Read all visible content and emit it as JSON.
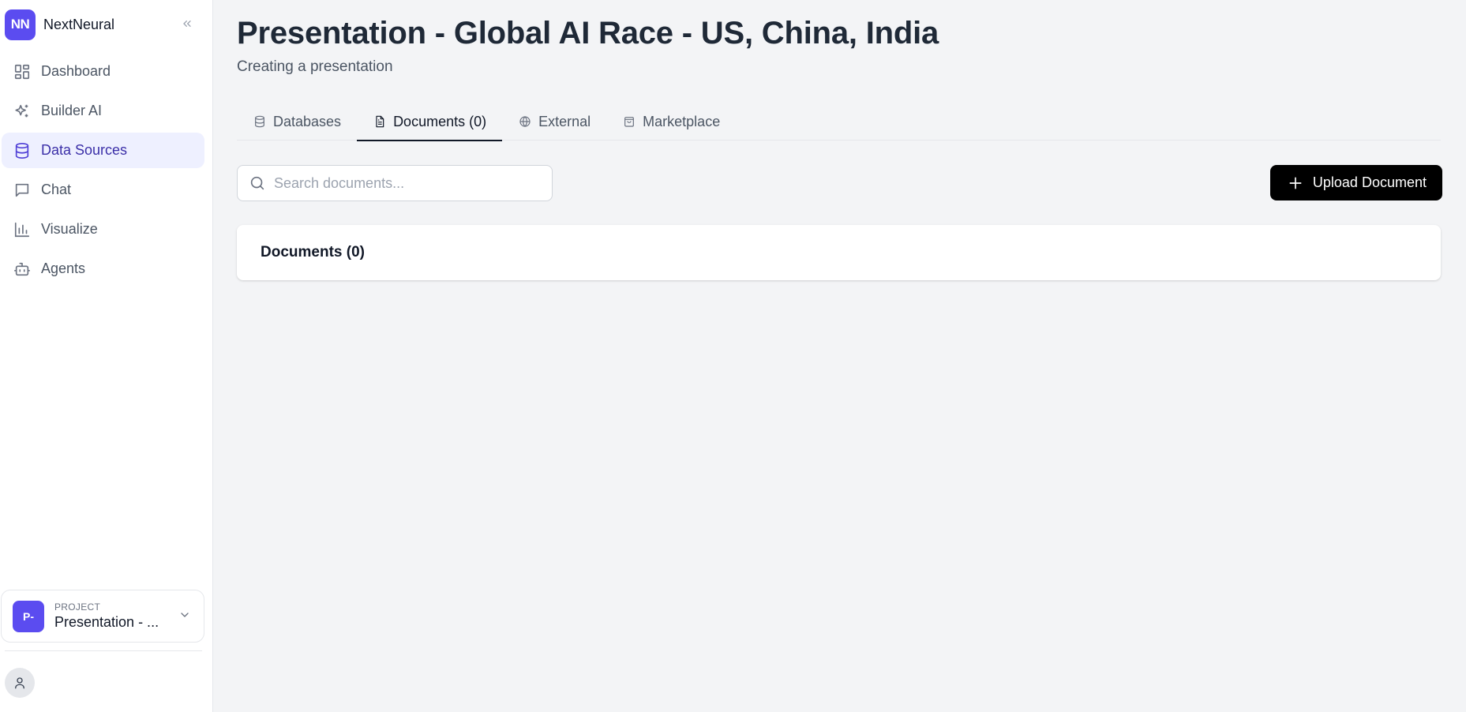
{
  "brand": {
    "logo_text": "NN",
    "name": "NextNeural"
  },
  "sidebar": {
    "items": [
      {
        "label": "Dashboard",
        "icon": "dashboard-grid-icon",
        "active": false
      },
      {
        "label": "Builder AI",
        "icon": "sparkles-icon",
        "active": false
      },
      {
        "label": "Data Sources",
        "icon": "database-icon",
        "active": true
      },
      {
        "label": "Chat",
        "icon": "chat-bubble-icon",
        "active": false
      },
      {
        "label": "Visualize",
        "icon": "bar-chart-icon",
        "active": false
      },
      {
        "label": "Agents",
        "icon": "robot-icon",
        "active": false
      }
    ],
    "project": {
      "caption": "PROJECT",
      "avatar_text": "P-",
      "name": "Presentation - ..."
    }
  },
  "page": {
    "title": "Presentation - Global AI Race - US, China, India",
    "subtitle": "Creating a presentation"
  },
  "tabs": [
    {
      "label": "Databases",
      "icon": "database-icon",
      "active": false
    },
    {
      "label": "Documents (0)",
      "icon": "document-icon",
      "active": true
    },
    {
      "label": "External",
      "icon": "globe-icon",
      "active": false
    },
    {
      "label": "Marketplace",
      "icon": "shopping-bag-icon",
      "active": false
    }
  ],
  "search": {
    "placeholder": "Search documents...",
    "value": ""
  },
  "upload_button": {
    "label": "Upload Document"
  },
  "documents_card": {
    "title": "Documents (0)"
  },
  "colors": {
    "brand": "#5b4cf0",
    "active_nav_bg": "#eef0ff",
    "active_nav_text": "#3b2fa8",
    "upload_button_bg": "#000000",
    "page_bg": "#f3f4f6"
  }
}
